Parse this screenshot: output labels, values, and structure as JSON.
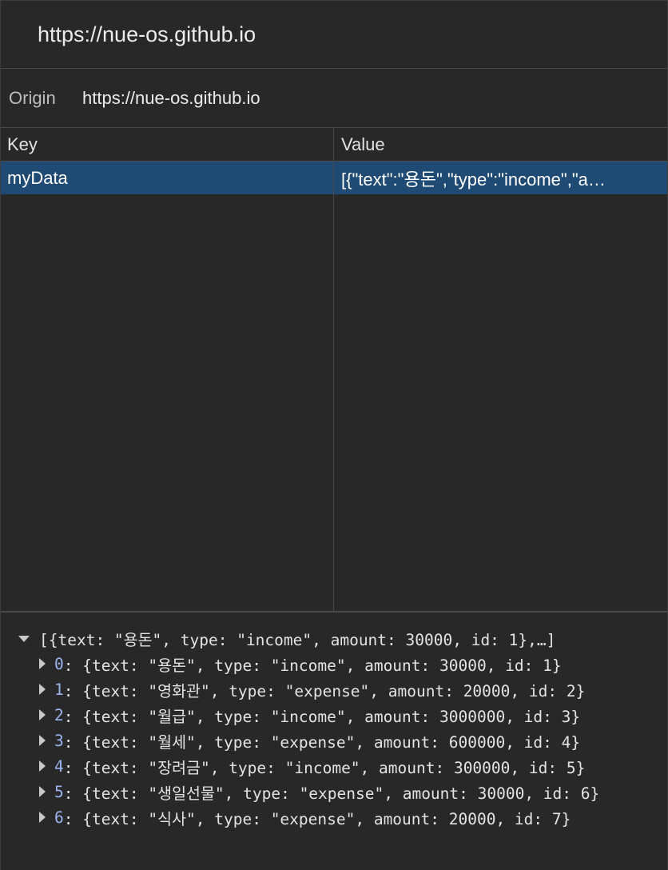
{
  "header": {
    "title": "https://nue-os.github.io"
  },
  "origin": {
    "label": "Origin",
    "value": "https://nue-os.github.io"
  },
  "table": {
    "columns": [
      "Key",
      "Value"
    ],
    "rows": [
      {
        "key": "myData",
        "value": "[{\"text\":\"용돈\",\"type\":\"income\",\"a…"
      }
    ]
  },
  "preview": {
    "root_summary": "[{text: \"용돈\", type: \"income\", amount: 30000, id: 1},…]",
    "items": [
      {
        "index": "0",
        "summary": ": {text: \"용돈\", type: \"income\", amount: 30000, id: 1}"
      },
      {
        "index": "1",
        "summary": ": {text: \"영화관\", type: \"expense\", amount: 20000, id: 2}"
      },
      {
        "index": "2",
        "summary": ": {text: \"월급\", type: \"income\", amount: 3000000, id: 3}"
      },
      {
        "index": "3",
        "summary": ": {text: \"월세\", type: \"expense\", amount: 600000, id: 4}"
      },
      {
        "index": "4",
        "summary": ": {text: \"장려금\", type: \"income\", amount: 300000, id: 5}"
      },
      {
        "index": "5",
        "summary": ": {text: \"생일선물\", type: \"expense\", amount: 30000, id: 6}"
      },
      {
        "index": "6",
        "summary": ": {text: \"식사\", type: \"expense\", amount: 20000, id: 7}"
      }
    ]
  },
  "colors": {
    "background": "#282828",
    "selected_row": "#1e4a73",
    "index_blue": "#9cb4f0"
  }
}
